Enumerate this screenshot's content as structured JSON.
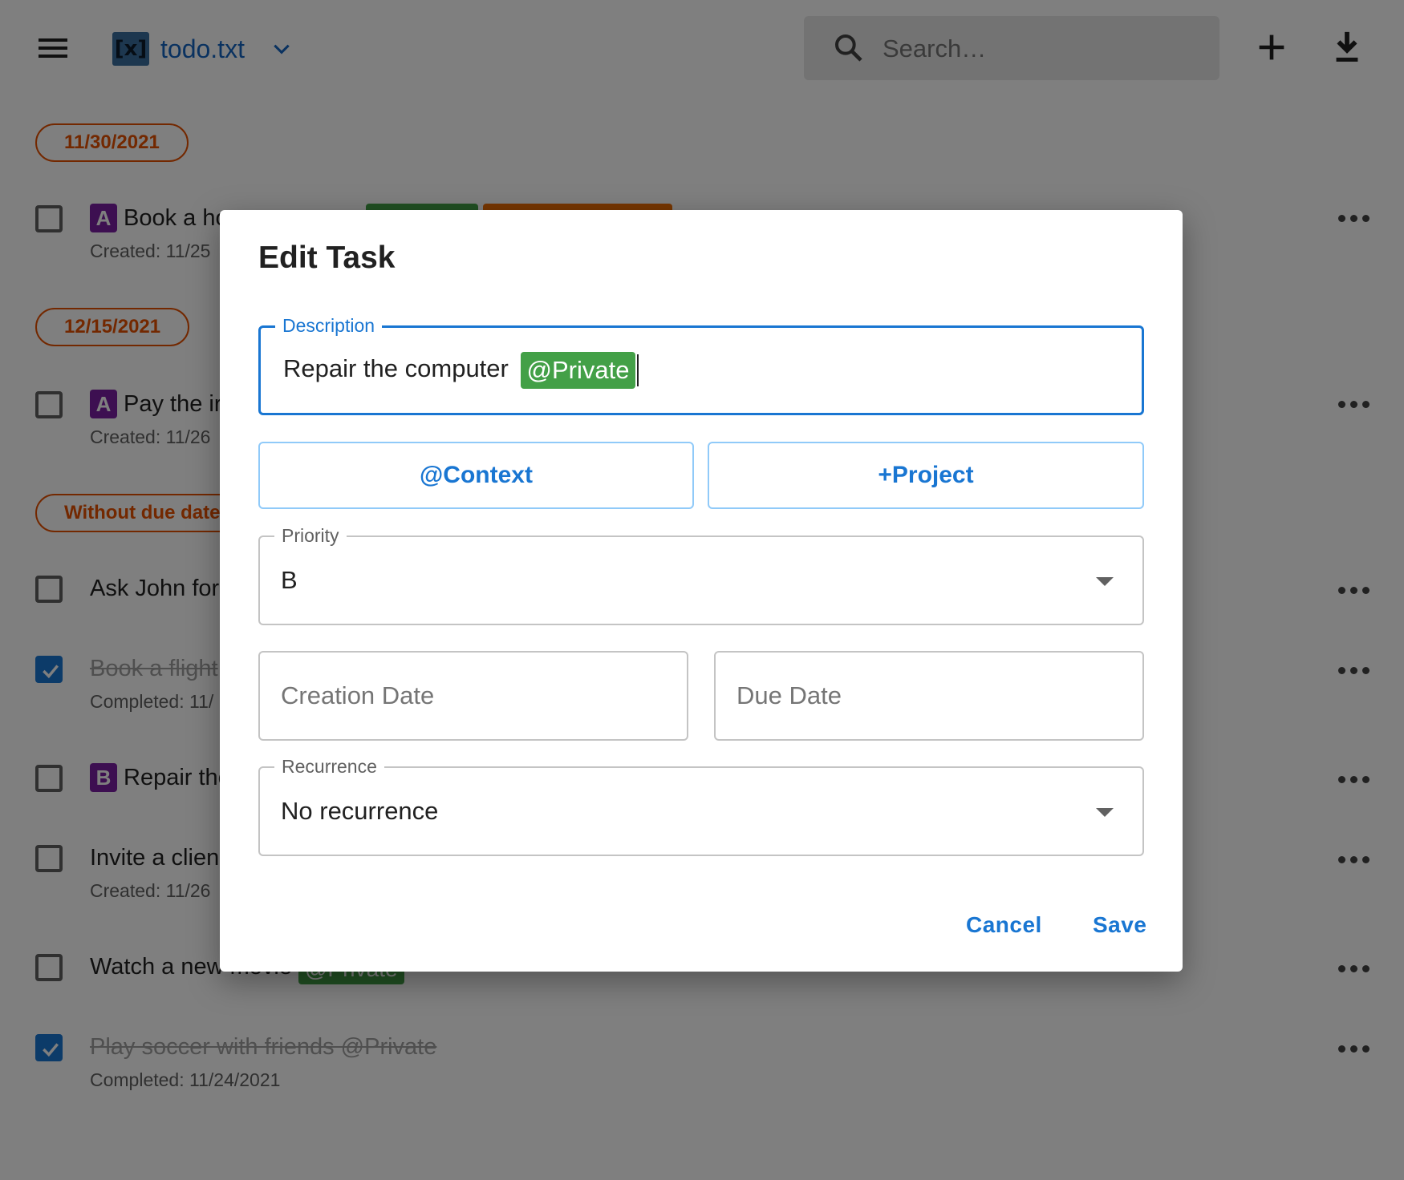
{
  "app": {
    "file_name": "todo.txt",
    "logo_text": "[x]",
    "search_placeholder": "Search…"
  },
  "icons": {
    "menu": "menu-icon",
    "logo": "todotxt-logo-icon",
    "file_menu": "chevron-down-icon",
    "search": "search-icon",
    "add": "plus-icon",
    "download": "download-icon",
    "more": "more-horizontal-icon",
    "select_arrow": "arrow-drop-down-icon"
  },
  "colors": {
    "accent": "#1976d2",
    "date_chip": "#e65100",
    "context_tag": "#43a047",
    "project_tag": "#ef6c00",
    "priority_badge": "#7b1fa2"
  },
  "groups": [
    {
      "label": "11/30/2021"
    },
    {
      "label": "12/15/2021"
    },
    {
      "label": "Without due date"
    }
  ],
  "tasks": [
    {
      "priority": "A",
      "text": "Book a ho",
      "meta": "Created: 11/25",
      "done": false
    },
    {
      "priority": "A",
      "text": "Pay the ir",
      "meta": "Created: 11/26",
      "done": false
    },
    {
      "text": "Ask John for",
      "done": false
    },
    {
      "text": "Book a flight",
      "meta": "Completed: 11/",
      "done": true
    },
    {
      "priority": "B",
      "text": "Repair the",
      "done": false
    },
    {
      "text": "Invite a clien",
      "meta": "Created: 11/26",
      "done": false
    },
    {
      "text": "Watch a new movie",
      "tag": "@Private",
      "done": false
    },
    {
      "text": "Play soccer with friends @Private",
      "meta": "Completed: 11/24/2021",
      "done": true
    }
  ],
  "dialog": {
    "title": "Edit Task",
    "description_label": "Description",
    "description_text": "Repair the computer",
    "description_tag": "@Private",
    "context_button": "@Context",
    "project_button": "+Project",
    "priority_label": "Priority",
    "priority_value": "B",
    "creation_date_placeholder": "Creation Date",
    "due_date_placeholder": "Due Date",
    "recurrence_label": "Recurrence",
    "recurrence_value": "No recurrence",
    "cancel_button": "Cancel",
    "save_button": "Save"
  }
}
